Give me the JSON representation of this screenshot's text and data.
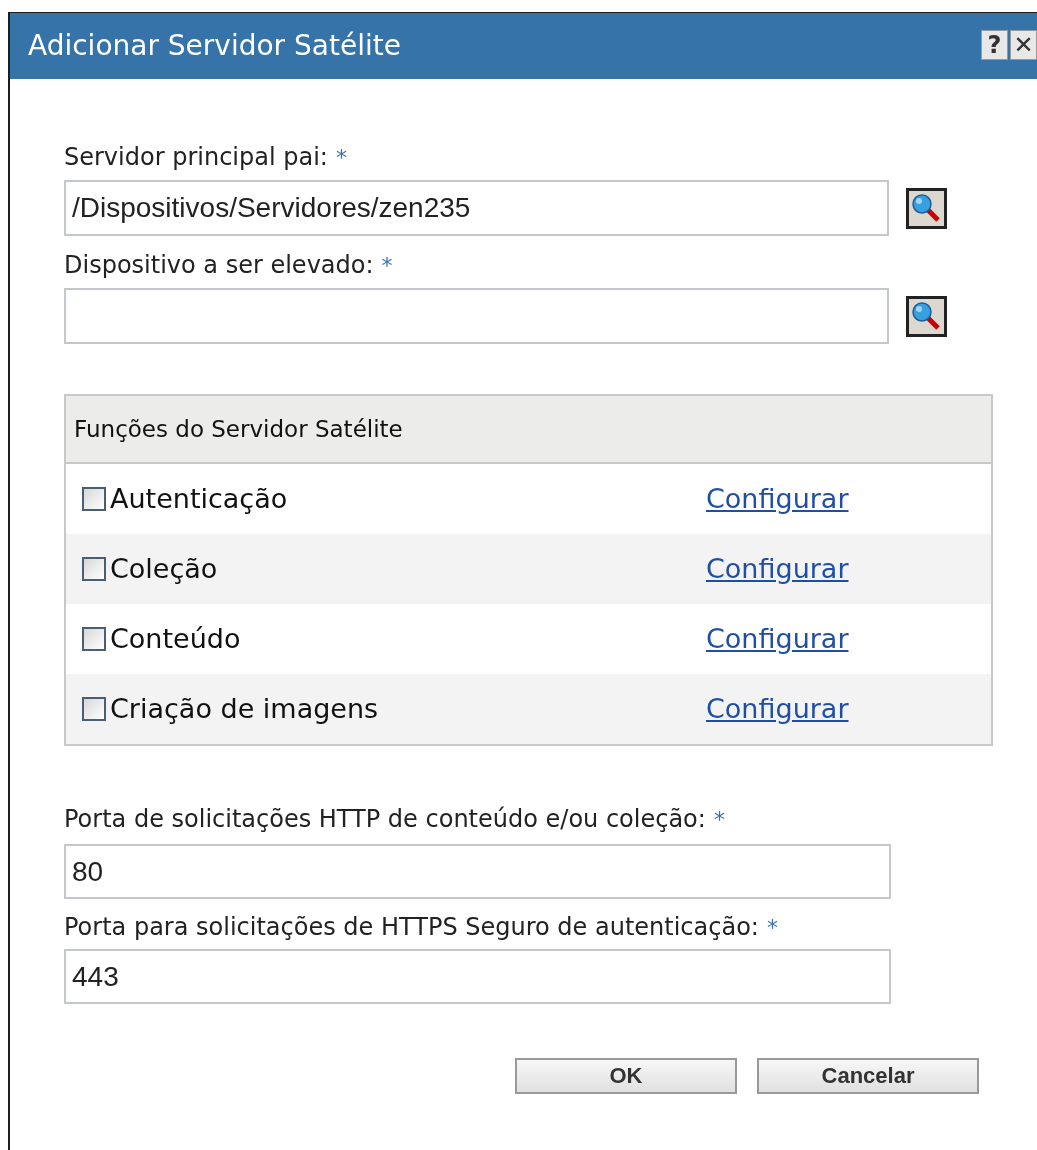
{
  "window": {
    "title": "Adicionar Servidor Satélite",
    "title_buttons": [
      "?",
      "✕"
    ]
  },
  "fields": [
    {
      "kind": "browse",
      "label": "Servidor principal pai:",
      "required_mark": "*",
      "value": "/Dispositivos/Servidores/zen235"
    },
    {
      "kind": "browse",
      "label": "Dispositivo a ser elevado:",
      "required_mark": "*"
    }
  ],
  "roles": {
    "title": "Funções do Servidor Satélite",
    "items": [
      {
        "label": "Autenticação",
        "checked": false,
        "link": "Configurar"
      },
      {
        "label": "Coleção",
        "checked": false,
        "link": "Configurar"
      },
      {
        "label": "Conteúdo",
        "checked": false,
        "link": "Configurar"
      },
      {
        "label": "Criação de imagens",
        "checked": false,
        "link": "Configurar"
      }
    ]
  },
  "ports": [
    {
      "label": "Porta de solicitações HTTP de conteúdo e/ou coleção:",
      "required_mark": "*",
      "value": "80"
    },
    {
      "label": "Porta para solicitações de HTTPS Seguro de autenticação:",
      "required_mark": "*",
      "value": "443"
    }
  ],
  "buttons": [
    "OK",
    "Cancelar"
  ]
}
